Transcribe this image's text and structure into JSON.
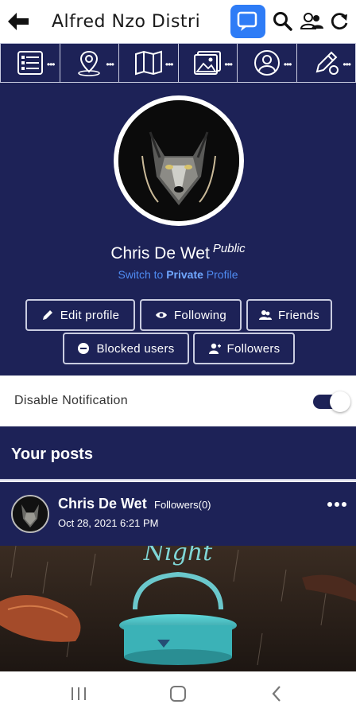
{
  "appbar": {
    "title": "Alfred Nzo Distri"
  },
  "menu": {
    "items": [
      {
        "icon": "list-icon"
      },
      {
        "icon": "map-pin-icon"
      },
      {
        "icon": "map-icon"
      },
      {
        "icon": "gallery-icon"
      },
      {
        "icon": "user-circle-icon"
      },
      {
        "icon": "edit-icon"
      }
    ]
  },
  "profile": {
    "name": "Chris De Wet",
    "visibility": "Public",
    "switch_prefix": "Switch to ",
    "switch_mode": "Private",
    "switch_suffix": " Profile",
    "buttons": {
      "edit": "Edit profile",
      "following": "Following",
      "friends": "Friends",
      "blocked": "Blocked users",
      "followers": "Followers"
    }
  },
  "notification": {
    "label": "Disable Notification",
    "enabled": true
  },
  "posts": {
    "title": "Your posts",
    "items": [
      {
        "author": "Chris De Wet",
        "audience": "Followers(0)",
        "date": "Oct 28, 2021 6:21 PM",
        "image_text": "Night"
      }
    ]
  },
  "colors": {
    "primary": "#1d2257",
    "accent": "#2e7cf6",
    "link": "#4f8cf3"
  }
}
